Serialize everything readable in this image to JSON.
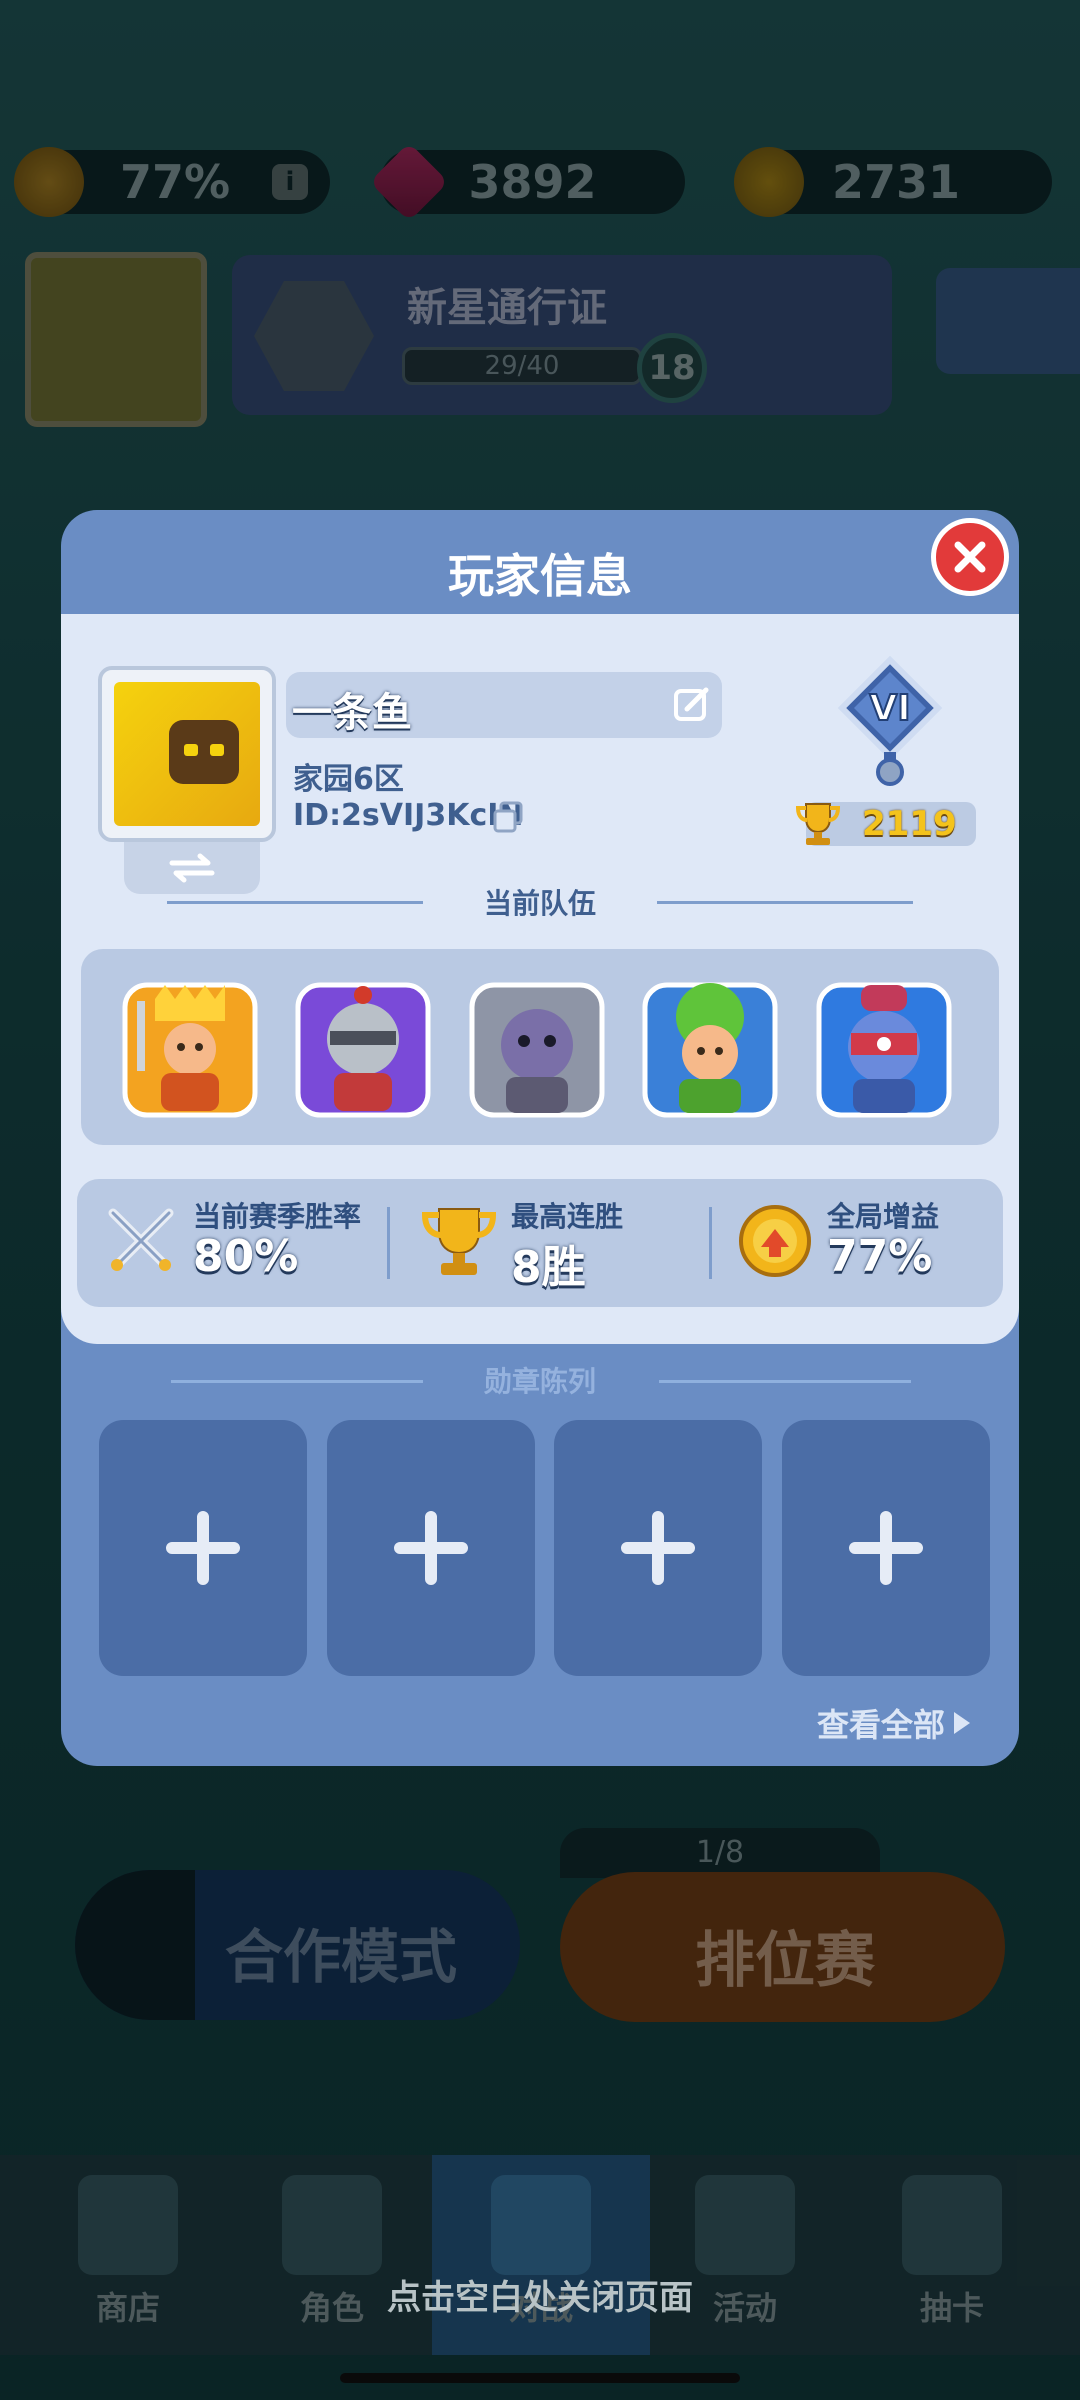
{
  "resources": {
    "gain": "77%",
    "gems": "3892",
    "coins": "2731"
  },
  "pass": {
    "title": "新星通行证",
    "progress": "29/40",
    "level": "18"
  },
  "lobby": {
    "coop_label": "合作模式",
    "ranked_label": "排位赛",
    "ranked_count": "1/8"
  },
  "nav": {
    "shop": "商店",
    "heroes": "角色",
    "battle": "对战",
    "events": "活动",
    "gacha": "抽卡"
  },
  "modal": {
    "title": "玩家信息",
    "player_name": "一条鱼",
    "server": "家园6区",
    "player_id": "ID:2sVIJ3KcIN",
    "rank": "VI",
    "trophies": "2119",
    "team_title": "当前队伍",
    "stats": [
      {
        "label": "当前赛季胜率",
        "value": "80%",
        "icon": "crossed-swords-icon"
      },
      {
        "label": "最高连胜",
        "value": "8胜",
        "icon": "trophy-icon"
      },
      {
        "label": "全局增益",
        "value": "77%",
        "icon": "gain-badge-icon"
      }
    ],
    "medal_title": "勋章陈列",
    "view_all": "查看全部"
  },
  "close_hint": "点击空白处关闭页面",
  "colors": {
    "modal_bg": "#6a8dc4",
    "panel_bg": "#dfe8f7",
    "close_red": "#e23a3a",
    "trophy_gold": "#f4c31c"
  }
}
